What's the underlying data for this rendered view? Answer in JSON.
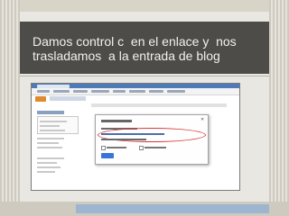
{
  "slide": {
    "title": "Damos control c  en el enlace y  nos\ntrasladamos  a la entrada de blog"
  }
}
